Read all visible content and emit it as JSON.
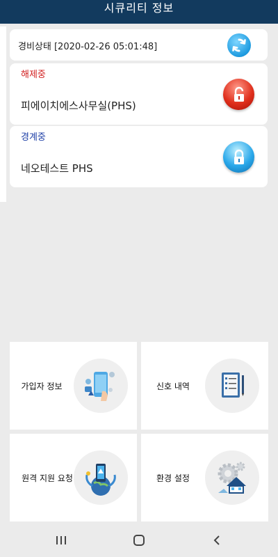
{
  "header": {
    "title": "시큐리티 정보"
  },
  "status": {
    "text": "경비상태 [2020-02-26 05:01:48]"
  },
  "sites": [
    {
      "state": "해제중",
      "name": "피에이치에스사무실(PHS)"
    },
    {
      "state": "경계중",
      "name": "네오테스트 PHS"
    }
  ],
  "menu": {
    "subscriber": "가입자 정보",
    "signal": "신호 내역",
    "remote": "원격 지원 요청",
    "settings": "환경 설정"
  },
  "colors": {
    "header": "#123a5e",
    "disarmed": "#d11f1f",
    "armed": "#1d3ea6",
    "refresh": "#1e9be0"
  },
  "icons": {
    "refresh": "refresh-icon",
    "unlock": "unlocked-padlock-icon",
    "lock": "locked-padlock-icon",
    "subscriber": "phone-profile-icon",
    "signal": "clipboard-list-icon",
    "remote": "remote-support-phone-icon",
    "settings": "gear-house-icon"
  }
}
